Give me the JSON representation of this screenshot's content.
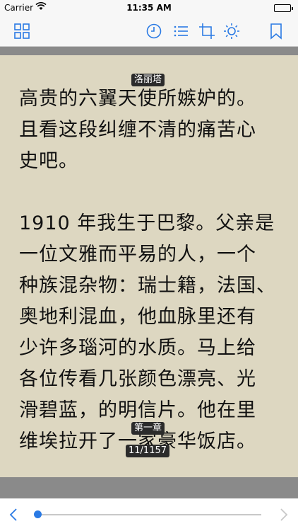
{
  "status_bar": {
    "carrier": "Carrier",
    "time": "11:35 AM"
  },
  "toolbar": {
    "icons": [
      "grid-icon",
      "clock-icon",
      "list-icon",
      "crop-icon",
      "brightness-icon",
      "bookmark-icon"
    ],
    "accent_color": "#2a7ae4"
  },
  "page": {
    "chapter_tag": "洛丽塔",
    "paragraphs": [
      "高贵的六翼天使所嫉妒的。\n且看这段纠缠不清的痛苦心\n史吧。",
      "1910 年我生于巴黎。父亲是\n一位文雅而平易的人，一个\n种族混杂物：瑞士籍，法国、\n奥地利混血，他血脉里还有\n少许多瑙河的水质。马上给\n各位传看几张颜色漂亮、光\n滑碧蓝，的明信片。他在里\n维埃拉开了一家豪华饭店。"
    ],
    "chapter_footer": "第一章",
    "page_counter": "11/1157",
    "background_color": "#ddd7c1"
  },
  "slider": {
    "progress": 0.01
  }
}
